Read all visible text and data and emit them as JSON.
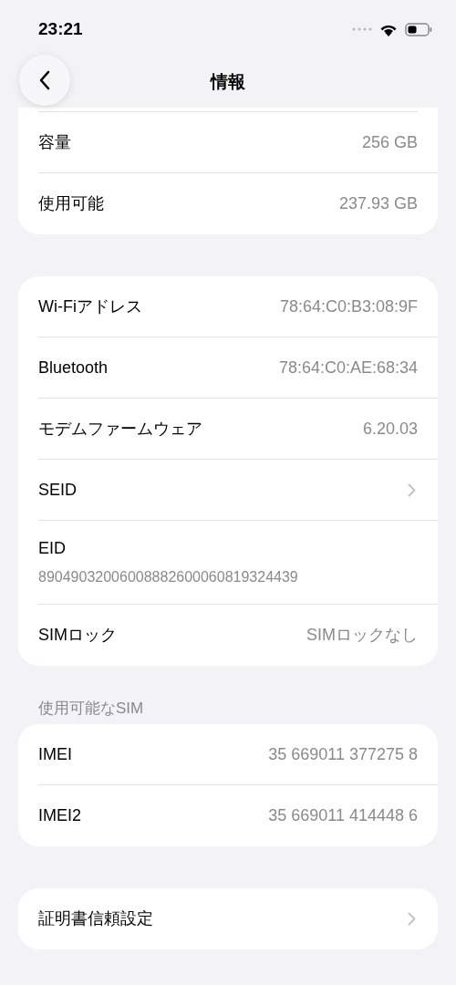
{
  "status_bar": {
    "time": "23:21"
  },
  "nav": {
    "title": "情報"
  },
  "groups": [
    {
      "cut_top": true,
      "rows": [
        {
          "kind": "value",
          "label": "容量",
          "value": "256 GB"
        },
        {
          "kind": "value",
          "label": "使用可能",
          "value": "237.93 GB"
        }
      ]
    },
    {
      "rows": [
        {
          "kind": "value",
          "label": "Wi-Fiアドレス",
          "value": "78:64:C0:B3:08:9F"
        },
        {
          "kind": "value",
          "label": "Bluetooth",
          "value": "78:64:C0:AE:68:34"
        },
        {
          "kind": "value",
          "label": "モデムファームウェア",
          "value": "6.20.03"
        },
        {
          "kind": "link",
          "label": "SEID"
        },
        {
          "kind": "stacked",
          "label": "EID",
          "value": "89049032006008882600060819324439"
        },
        {
          "kind": "value",
          "label": "SIMロック",
          "value": "SIMロックなし"
        }
      ]
    },
    {
      "header": "使用可能なSIM",
      "rows": [
        {
          "kind": "value",
          "label": "IMEI",
          "value": "35 669011 377275 8"
        },
        {
          "kind": "value",
          "label": "IMEI2",
          "value": "35 669011 414448 6"
        }
      ]
    },
    {
      "rows": [
        {
          "kind": "link",
          "label": "証明書信頼設定"
        }
      ]
    }
  ]
}
